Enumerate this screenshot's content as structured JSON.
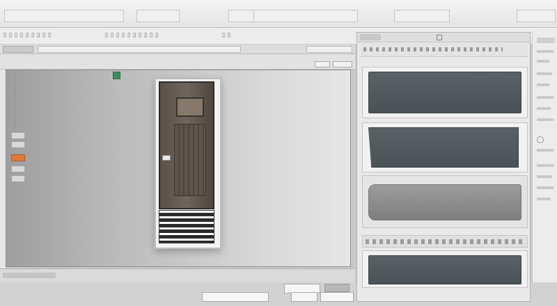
{
  "colors": {
    "accent_orange": "#e07a3c",
    "marker_green": "#3a8f5c",
    "door_brown": "#5a5048",
    "thumb_slate": "#4a5256"
  },
  "icons": [
    "green-marker-icon",
    "search-icon",
    "door-handle-icon"
  ],
  "statusbar": {
    "fields": [
      "",
      "",
      "",
      "",
      ""
    ]
  }
}
